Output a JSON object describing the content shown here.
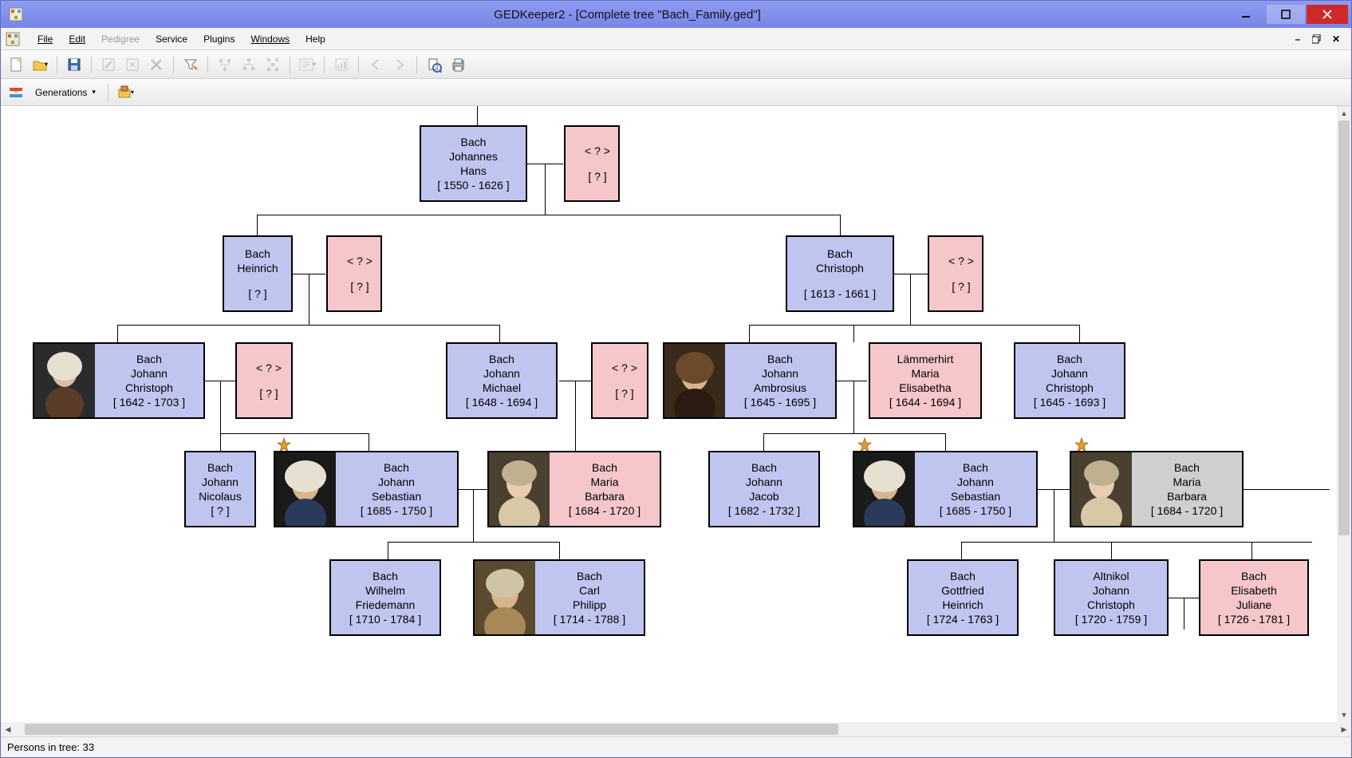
{
  "title": "GEDKeeper2 - [Complete tree \"Bach_Family.ged\"]",
  "menu": {
    "file": "File",
    "edit": "Edit",
    "pedigree": "Pedigree",
    "service": "Service",
    "plugins": "Plugins",
    "windows": "Windows",
    "help": "Help"
  },
  "toolbar2": {
    "generations": "Generations"
  },
  "status": {
    "persons": "Persons in tree: 33"
  },
  "persons": {
    "johannes": {
      "line1": "Bach",
      "line2": "Johannes",
      "line3": "Hans",
      "dates": "[ 1550 - 1626 ]"
    },
    "unk1": {
      "line1": "< ? >",
      "dates": "[ ? ]"
    },
    "heinrich": {
      "line1": "Bach",
      "line2": "Heinrich",
      "dates": "[ ? ]"
    },
    "unk2": {
      "line1": "< ? >",
      "dates": "[ ? ]"
    },
    "christoph1": {
      "line1": "Bach",
      "line2": "Christoph",
      "dates": "[ 1613 - 1661 ]"
    },
    "unk3": {
      "line1": "< ? >",
      "dates": "[ ? ]"
    },
    "jchristoph1": {
      "line1": "Bach",
      "line2": "Johann",
      "line3": "Christoph",
      "dates": "[ 1642 - 1703 ]"
    },
    "unk4": {
      "line1": "< ? >",
      "dates": "[ ? ]"
    },
    "jmichael": {
      "line1": "Bach",
      "line2": "Johann",
      "line3": "Michael",
      "dates": "[ 1648 - 1694 ]"
    },
    "unk5": {
      "line1": "< ? >",
      "dates": "[ ? ]"
    },
    "ambrosius": {
      "line1": "Bach",
      "line2": "Johann",
      "line3": "Ambrosius",
      "dates": "[ 1645 - 1695 ]"
    },
    "lammerhirt": {
      "line1": "Lämmerhirt",
      "line2": "Maria",
      "line3": "Elisabetha",
      "dates": "[ 1644 - 1694 ]"
    },
    "jchristoph2": {
      "line1": "Bach",
      "line2": "Johann",
      "line3": "Christoph",
      "dates": "[ 1645 - 1693 ]"
    },
    "nicolaus": {
      "line1": "Bach",
      "line2": "Johann",
      "line3": "Nicolaus",
      "dates": "[ ? ]"
    },
    "jsbach1": {
      "line1": "Bach",
      "line2": "Johann",
      "line3": "Sebastian",
      "dates": "[ 1685 - 1750 ]"
    },
    "mbarbara1": {
      "line1": "Bach",
      "line2": "Maria",
      "line3": "Barbara",
      "dates": "[ 1684 - 1720 ]"
    },
    "jacob": {
      "line1": "Bach",
      "line2": "Johann",
      "line3": "Jacob",
      "dates": "[ 1682 - 1732 ]"
    },
    "jsbach2": {
      "line1": "Bach",
      "line2": "Johann",
      "line3": "Sebastian",
      "dates": "[ 1685 - 1750 ]"
    },
    "mbarbara2": {
      "line1": "Bach",
      "line2": "Maria",
      "line3": "Barbara",
      "dates": "[ 1684 - 1720 ]"
    },
    "wfriedemann": {
      "line1": "Bach",
      "line2": "Wilhelm",
      "line3": "Friedemann",
      "dates": "[ 1710 - 1784 ]"
    },
    "cphilipp": {
      "line1": "Bach",
      "line2": "Carl",
      "line3": "Philipp",
      "dates": "[ 1714 - 1788 ]"
    },
    "gottfried": {
      "line1": "Bach",
      "line2": "Gottfried",
      "line3": "Heinrich",
      "dates": "[ 1724 - 1763 ]"
    },
    "altnikol": {
      "line1": "Altnikol",
      "line2": "Johann",
      "line3": "Christoph",
      "dates": "[ 1720 - 1759 ]"
    },
    "juliane": {
      "line1": "Bach",
      "line2": "Elisabeth",
      "line3": "Juliane",
      "dates": "[ 1726 - 1781 ]"
    }
  }
}
